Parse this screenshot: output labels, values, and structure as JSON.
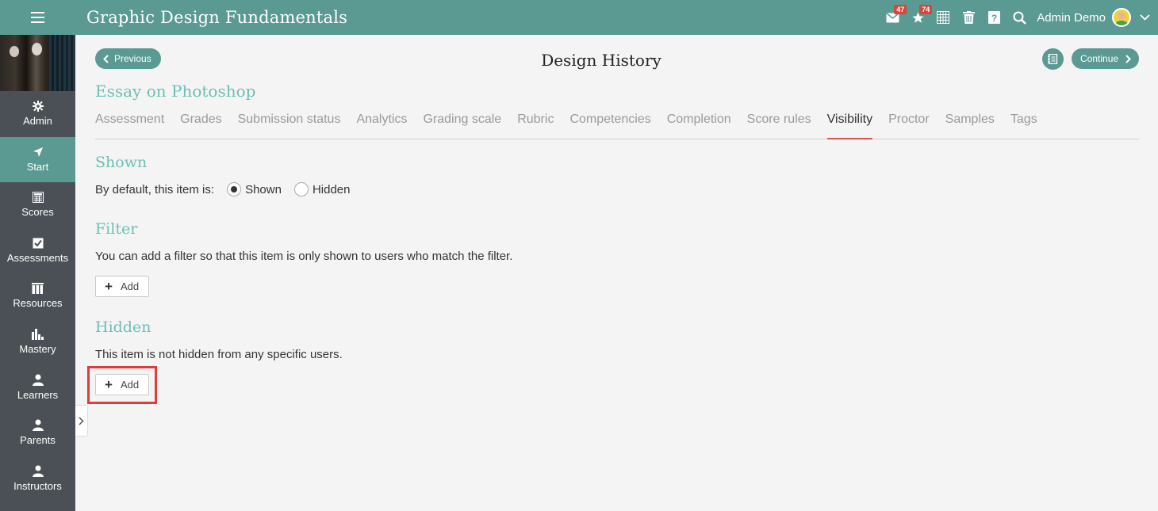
{
  "header": {
    "title": "Graphic Design Fundamentals",
    "messages_badge": "47",
    "notifications_badge": "74",
    "user_name": "Admin Demo"
  },
  "sidebar": {
    "items": [
      {
        "label": "Admin",
        "icon": "gear-icon"
      },
      {
        "label": "Start",
        "icon": "navigation-arrow-icon"
      },
      {
        "label": "Scores",
        "icon": "gradebook-icon"
      },
      {
        "label": "Assessments",
        "icon": "checklist-icon"
      },
      {
        "label": "Resources",
        "icon": "books-icon"
      },
      {
        "label": "Mastery",
        "icon": "bar-chart-icon"
      },
      {
        "label": "Learners",
        "icon": "person-icon"
      },
      {
        "label": "Parents",
        "icon": "person-icon"
      },
      {
        "label": "Instructors",
        "icon": "person-icon"
      }
    ],
    "active_index": 1
  },
  "page": {
    "previous_label": "Previous",
    "continue_label": "Continue",
    "title": "Design History",
    "item_title": "Essay on Photoshop"
  },
  "tabs": [
    "Assessment",
    "Grades",
    "Submission status",
    "Analytics",
    "Grading scale",
    "Rubric",
    "Competencies",
    "Completion",
    "Score rules",
    "Visibility",
    "Proctor",
    "Samples",
    "Tags"
  ],
  "active_tab": "Visibility",
  "shown_section": {
    "title": "Shown",
    "prompt": "By default, this item is:",
    "options": [
      "Shown",
      "Hidden"
    ],
    "selected": "Shown"
  },
  "filter_section": {
    "title": "Filter",
    "description": "You can add a filter so that this item is only shown to users who match the filter.",
    "add_label": "Add"
  },
  "hidden_section": {
    "title": "Hidden",
    "description": "This item is not hidden from any specific users.",
    "add_label": "Add"
  },
  "colors": {
    "brand": "#5a9a93",
    "section_title": "#6cbfb5",
    "sidebar_bg": "#4a5055",
    "active_tab_underline": "#d9534f",
    "badge": "#d9443b",
    "highlight": "#e23b3b"
  }
}
